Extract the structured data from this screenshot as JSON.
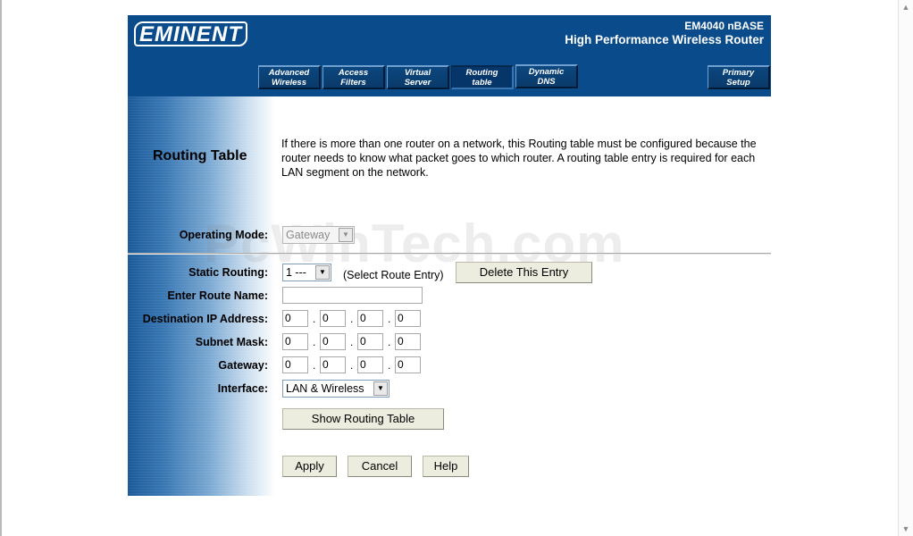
{
  "header": {
    "logo": "EMINENT",
    "model": "EM4040 nBASE",
    "subtitle": "High Performance Wireless Router",
    "brand_color": "#0a4b8c",
    "tabs": [
      {
        "line1": "Advanced",
        "line2": "Wireless"
      },
      {
        "line1": "Access",
        "line2": "Filters"
      },
      {
        "line1": "Virtual",
        "line2": "Server"
      },
      {
        "line1": "Routing",
        "line2": "table"
      },
      {
        "line1": "Dynamic",
        "line2": "DNS"
      },
      {
        "line1": "Primary",
        "line2": "Setup"
      }
    ],
    "active_tab": "Routing table"
  },
  "page": {
    "title": "Routing Table",
    "description": "If there is more than one router on a network, this Routing table must be configured because the router needs to know what packet goes to which router. A routing table entry is required for each LAN segment on the network."
  },
  "form": {
    "operating_mode": {
      "label": "Operating Mode:",
      "value": "Gateway"
    },
    "static_routing": {
      "label": "Static Routing:",
      "value": "1 ---",
      "hint": "(Select Route Entry)",
      "delete_label": "Delete This Entry"
    },
    "route_name": {
      "label": "Enter Route Name:",
      "value": ""
    },
    "destination_ip": {
      "label": "Destination IP Address:",
      "octets": [
        "0",
        "0",
        "0",
        "0"
      ]
    },
    "subnet_mask": {
      "label": "Subnet Mask:",
      "octets": [
        "0",
        "0",
        "0",
        "0"
      ]
    },
    "gateway": {
      "label": "Gateway:",
      "octets": [
        "0",
        "0",
        "0",
        "0"
      ]
    },
    "interface": {
      "label": "Interface:",
      "value": "LAN & Wireless"
    },
    "show_routing_table_label": "Show Routing Table"
  },
  "actions": {
    "apply": "Apply",
    "cancel": "Cancel",
    "help": "Help"
  },
  "watermark": "PcWinTech.com",
  "icons": {
    "dropdown": "chevron-down-icon"
  }
}
